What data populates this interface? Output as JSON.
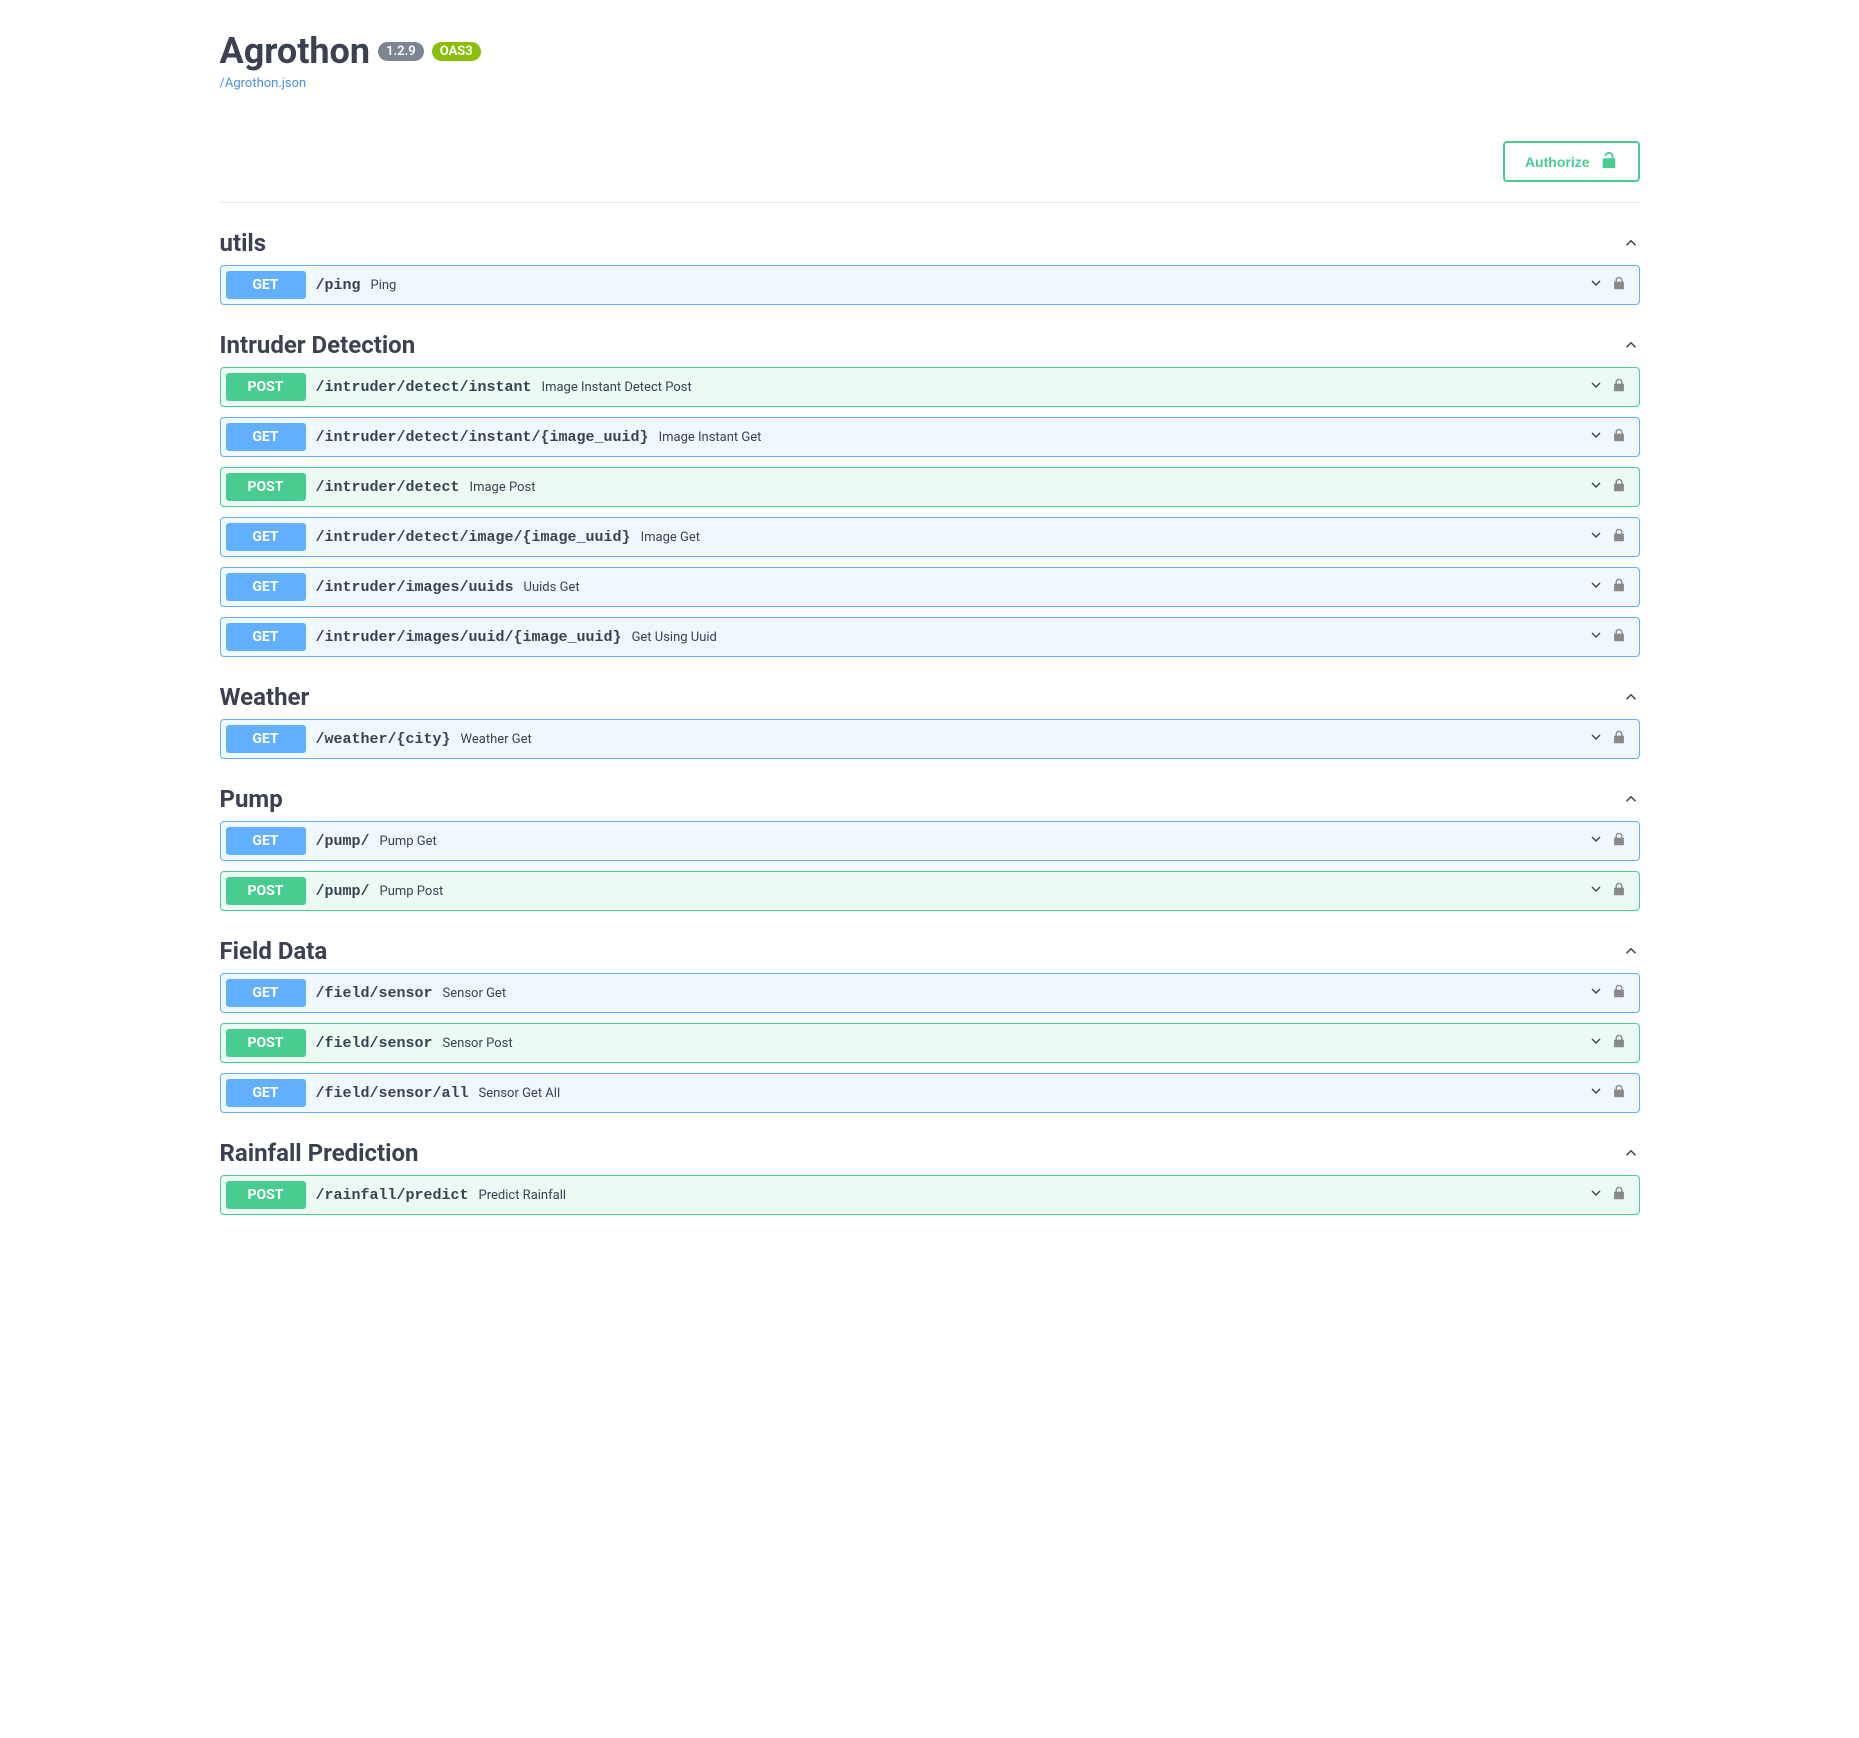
{
  "header": {
    "title": "Agrothon",
    "version": "1.2.9",
    "oas": "OAS3",
    "spec_link": "/Agrothon.json"
  },
  "authorize_label": "Authorize",
  "tags": [
    {
      "name": "utils",
      "ops": [
        {
          "method": "GET",
          "path": "/ping",
          "desc": "Ping"
        }
      ]
    },
    {
      "name": "Intruder Detection",
      "ops": [
        {
          "method": "POST",
          "path": "/intruder/detect/instant",
          "desc": "Image Instant Detect Post"
        },
        {
          "method": "GET",
          "path": "/intruder/detect/instant/{image_uuid}",
          "desc": "Image Instant Get"
        },
        {
          "method": "POST",
          "path": "/intruder/detect",
          "desc": "Image Post"
        },
        {
          "method": "GET",
          "path": "/intruder/detect/image/{image_uuid}",
          "desc": "Image Get"
        },
        {
          "method": "GET",
          "path": "/intruder/images/uuids",
          "desc": "Uuids Get"
        },
        {
          "method": "GET",
          "path": "/intruder/images/uuid/{image_uuid}",
          "desc": "Get Using Uuid"
        }
      ]
    },
    {
      "name": "Weather",
      "ops": [
        {
          "method": "GET",
          "path": "/weather/{city}",
          "desc": "Weather Get"
        }
      ]
    },
    {
      "name": "Pump",
      "ops": [
        {
          "method": "GET",
          "path": "/pump/",
          "desc": "Pump Get"
        },
        {
          "method": "POST",
          "path": "/pump/",
          "desc": "Pump Post"
        }
      ]
    },
    {
      "name": "Field Data",
      "ops": [
        {
          "method": "GET",
          "path": "/field/sensor",
          "desc": "Sensor Get"
        },
        {
          "method": "POST",
          "path": "/field/sensor",
          "desc": "Sensor Post"
        },
        {
          "method": "GET",
          "path": "/field/sensor/all",
          "desc": "Sensor Get All"
        }
      ]
    },
    {
      "name": "Rainfall Prediction",
      "ops": [
        {
          "method": "POST",
          "path": "/rainfall/predict",
          "desc": "Predict Rainfall"
        }
      ]
    }
  ]
}
